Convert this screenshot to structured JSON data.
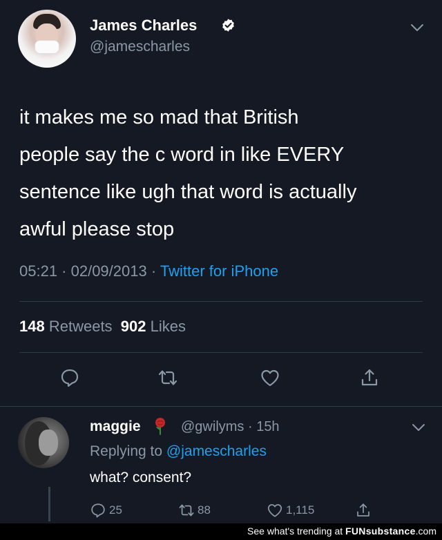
{
  "tweet": {
    "author": {
      "display_name": "James Charles",
      "handle": "@jamescharles",
      "verified": true
    },
    "text_lines": [
      "it makes me so mad that British",
      "people say the c word in like EVERY",
      "sentence like ugh that word is actually",
      "awful please stop"
    ],
    "timestamp": "05:21 · 02/09/2013 ·",
    "source": "Twitter for iPhone",
    "retweets_count": "148",
    "retweets_label": "Retweets",
    "likes_count": "902",
    "likes_label": "Likes"
  },
  "reply": {
    "author": {
      "display_name": "maggie",
      "handle_time": "@gwilyms · 15h"
    },
    "replying_label": "Replying to",
    "replying_to": "@jamescharles",
    "text": "what? consent?",
    "reply_count": "25",
    "retweet_count": "88",
    "like_count": "1,115"
  },
  "footer": {
    "prefix": "See what's trending at",
    "brand_bold": "FUN",
    "brand_rest": "substance",
    "suffix": ".com"
  },
  "colors": {
    "background": "#141923",
    "secondary_text": "#8b98a5",
    "link": "#1da1f2",
    "divider": "#2f3944"
  },
  "icons": {
    "verified": "verified-badge-icon",
    "chevron": "chevron-down-icon",
    "reply": "reply-bubble-icon",
    "retweet": "retweet-icon",
    "like": "heart-icon",
    "share": "share-icon",
    "emoji": "rose-icon"
  }
}
